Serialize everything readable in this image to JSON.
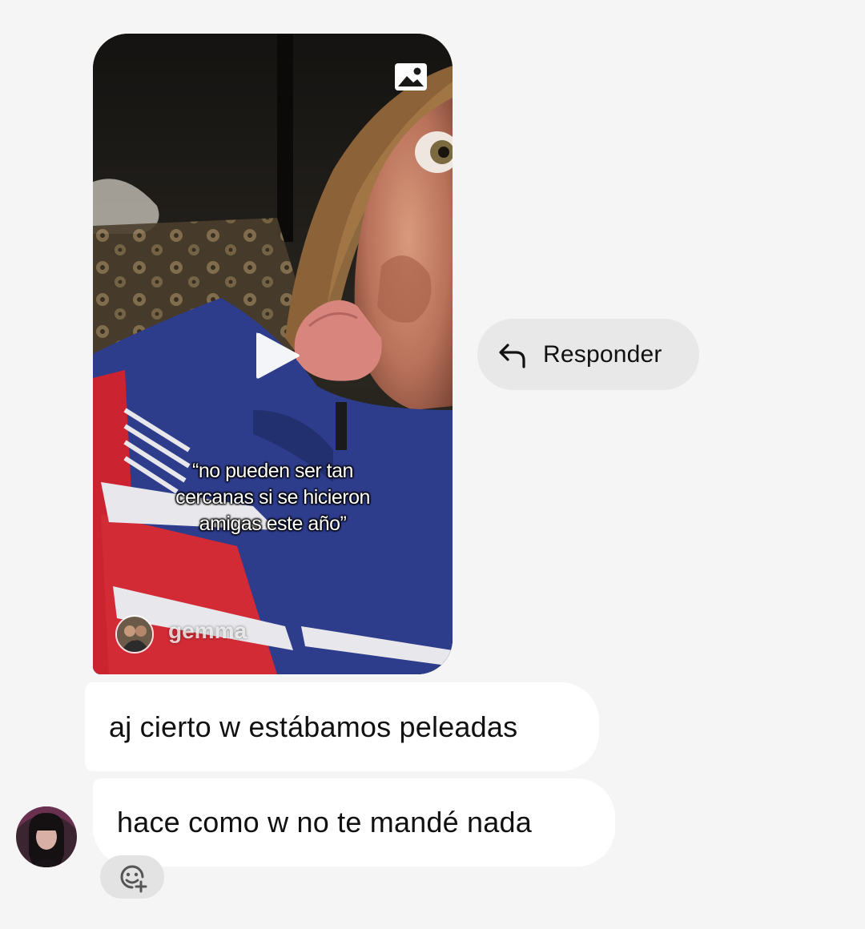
{
  "shared_video": {
    "caption_lines": [
      "“no pueden ser tan",
      "cercanas si se hicieron",
      "amigas este año”"
    ],
    "creator_name": "gemma",
    "media_icon": "image-icon",
    "play_icon": "play-icon"
  },
  "reply_action": {
    "label": "Responder",
    "icon": "reply-arrow-icon"
  },
  "messages": [
    {
      "text": "aj cierto w estábamos peleadas"
    },
    {
      "text": "hace como w no te mandé nada"
    }
  ],
  "reaction_button": {
    "icon": "add-reaction-icon"
  },
  "colors": {
    "background": "#f5f5f5",
    "bubble": "#ffffff",
    "reply_pill": "#e8e8e8",
    "text": "#111111"
  }
}
